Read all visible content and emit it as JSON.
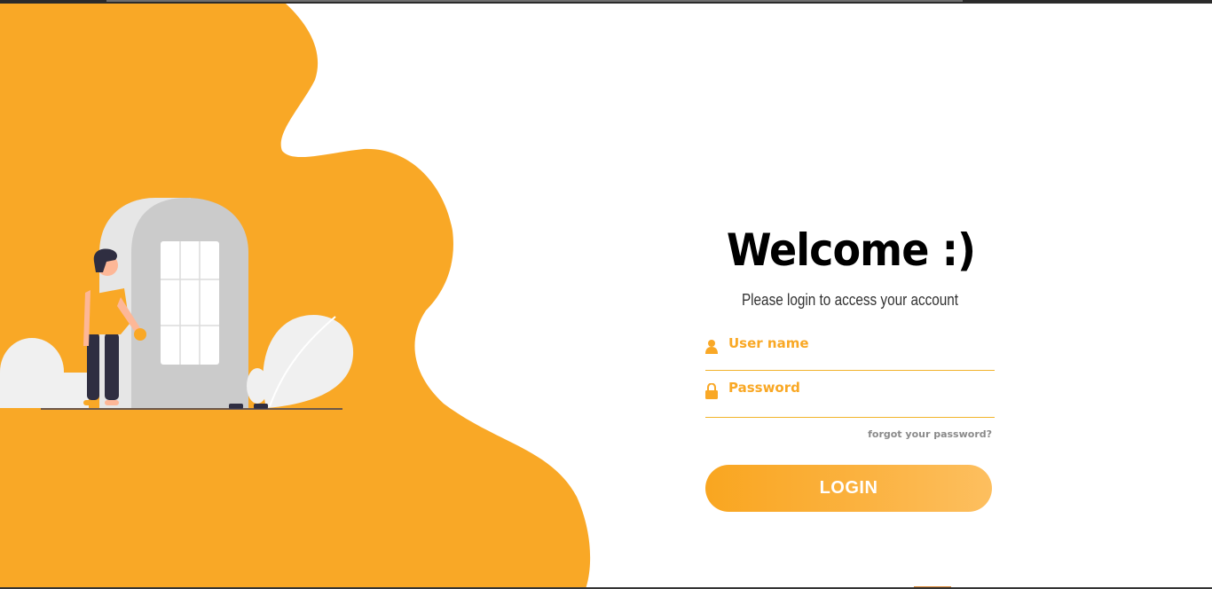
{
  "colors": {
    "brand": "#f9a826",
    "text_dark": "#000000",
    "muted": "#8a8a8a",
    "field_underline": "#f2b32a"
  },
  "login": {
    "title": "Welcome :)",
    "subtitle": "Please login to access your account",
    "username": {
      "icon": "user-icon",
      "placeholder": "User name",
      "value": ""
    },
    "password": {
      "icon": "lock-icon",
      "placeholder": "Password",
      "value": ""
    },
    "forgot_label": "forgot your password?",
    "login_label": "LOGIN"
  },
  "illustration": {
    "subject": "person-at-door-illustration"
  }
}
